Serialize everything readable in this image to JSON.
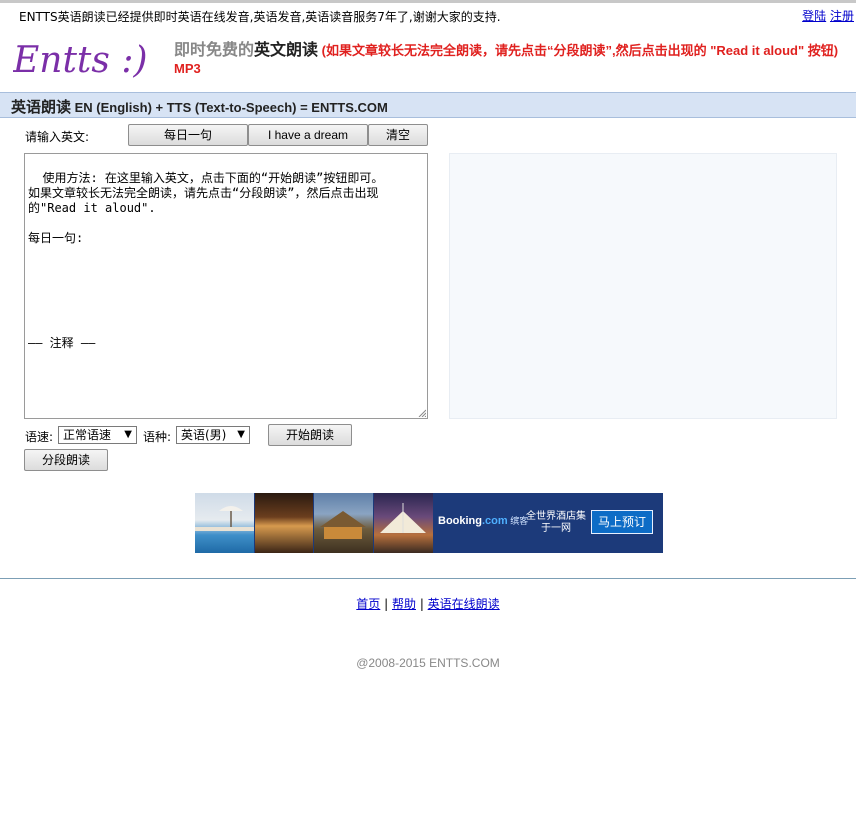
{
  "top": {
    "notice": "ENTTS英语朗读已经提供即时英语在线发音,英语发音,英语读音服务7年了,谢谢大家的支持.",
    "login": "登陆",
    "register": "注册"
  },
  "header": {
    "logo_text": "Entts :)",
    "tagline_grey": "即时免费的",
    "tagline_black": "英文朗读",
    "tagline_red": " (如果文章较长无法完全朗读，请先点击“分段朗读”,然后点击出现的 \"Read it aloud\" 按钮) MP3"
  },
  "titlebar": {
    "title": "英语朗读",
    "subtitle": " EN (English) + TTS (Text-to-Speech) = ENTTS.COM"
  },
  "form": {
    "input_label": "请输入英文:",
    "btn_daily": "每日一句",
    "btn_dream": "I have a dream",
    "btn_clear": "清空",
    "textarea": "使用方法: 在这里输入英文，点击下面的“开始朗读”按钮即可。\n如果文章较长无法完全朗读，请先点击“分段朗读”，然后点击出现的\"Read it aloud\".\n\n每日一句:\n\n\n\n\n\n\n—— 注释 ——",
    "speed_label": "语速:",
    "speed_value": "正常语速",
    "voice_label": "语种:",
    "voice_value": "英语(男)",
    "btn_start": "开始朗读",
    "btn_segment": "分段朗读"
  },
  "ad": {
    "brand": "Booking",
    "brand_tld": ".com",
    "brand_sub": " 缤客",
    "text": "全世界酒店集于一网",
    "button": "马上预订"
  },
  "footer": {
    "links": [
      "首页",
      "帮助",
      "英语在线朗读"
    ],
    "separator": " | ",
    "copyright": "@2008-2015 ENTTS.COM"
  },
  "colors": {
    "accent_red": "#e0211f",
    "titlebar_bg": "#d7e3f4",
    "logo_purple": "#7b2fa8",
    "booking_blue": "#1c3a7a"
  }
}
